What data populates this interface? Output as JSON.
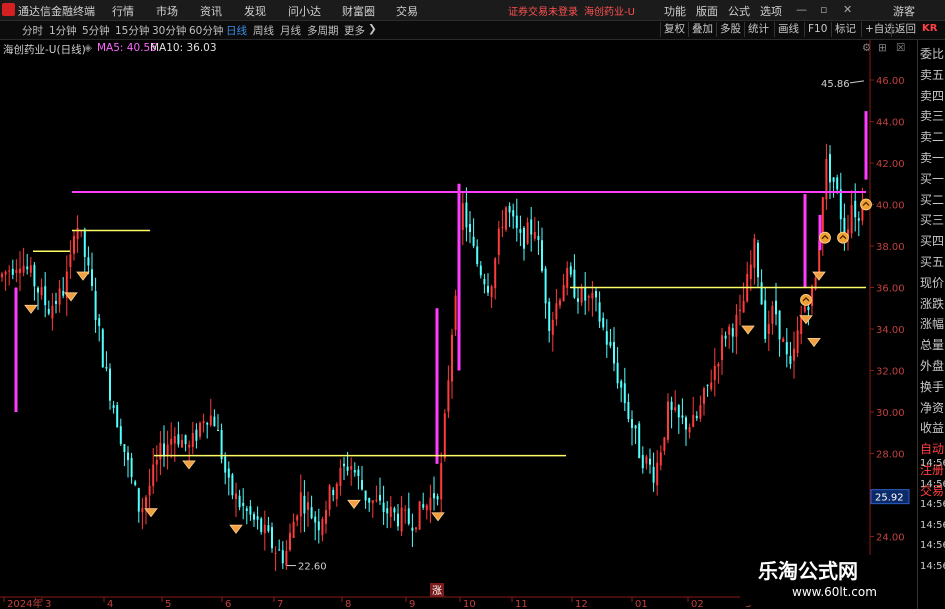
{
  "menubar": {
    "app_title": "通达信金融终端",
    "menus": [
      "行情",
      "市场",
      "资讯",
      "发现",
      "问小达",
      "财富圈",
      "交易"
    ],
    "login_warning": "证券交易未登录",
    "stock_warning": "海创药业-U",
    "right_menus": [
      "功能",
      "版面",
      "公式",
      "选项"
    ],
    "user": "游客"
  },
  "toolbar": {
    "periods": [
      "分时",
      "1分钟",
      "5分钟",
      "15分钟",
      "30分钟",
      "60分钟",
      "日线",
      "周线",
      "月线",
      "多周期",
      "更多"
    ],
    "active_period": "日线",
    "right_buttons": [
      "复权",
      "叠加",
      "多股",
      "统计",
      "画线",
      "F10",
      "标记",
      "+自选",
      "返回"
    ]
  },
  "infobar": {
    "stock": "海创药业-U(日线)",
    "ma5_label": "MA5: 40.56",
    "ma10_label": "MA10: 36.03",
    "colors": {
      "ma5": "#ff66ff",
      "ma10": "#e0e0e0"
    }
  },
  "right_panel": {
    "items": [
      "委比",
      "卖五",
      "卖四",
      "卖三",
      "卖二",
      "卖一",
      "买一",
      "买二",
      "买三",
      "买四",
      "买五",
      "现价",
      "涨跌",
      "涨幅",
      "总量",
      "外盘",
      "换手",
      "净资",
      "收益",
      "自动",
      "注册",
      "交易"
    ],
    "times": [
      "14:56",
      "14:56",
      "14:56",
      "14:56",
      "14:56",
      "14:56"
    ],
    "header": "KR"
  },
  "chart_data": {
    "type": "candlestick",
    "title": "",
    "price_labels": [
      "46.00",
      "44.00",
      "42.00",
      "40.00",
      "38.00",
      "36.00",
      "34.00",
      "32.00",
      "30.00",
      "28.00",
      "26.00",
      "24.00"
    ],
    "ylim": [
      22,
      48
    ],
    "current_price": "25.92",
    "max_label": "45.86",
    "min_label": "22.60",
    "x_labels": [
      "2024年",
      "3",
      "4",
      "5",
      "6",
      "7",
      "8",
      "9",
      "10",
      "11",
      "12",
      "01",
      "02",
      "3"
    ],
    "marker": "涨",
    "colors": {
      "up": "#ff3b3b",
      "down": "#54ffff",
      "ma5": "#ff3cff",
      "support": "#ffff66"
    },
    "support_lines": [
      {
        "name": "support-line-1",
        "price": 37.75
      },
      {
        "name": "support-line-2",
        "price": 38.75
      },
      {
        "name": "resistance-line",
        "price": 40.6
      },
      {
        "name": "support-line-3",
        "price": 27.9
      },
      {
        "name": "support-line-4",
        "price": 36.0
      }
    ]
  },
  "watermark": {
    "title": "乐淘公式网",
    "url": "www.60lt.com"
  }
}
